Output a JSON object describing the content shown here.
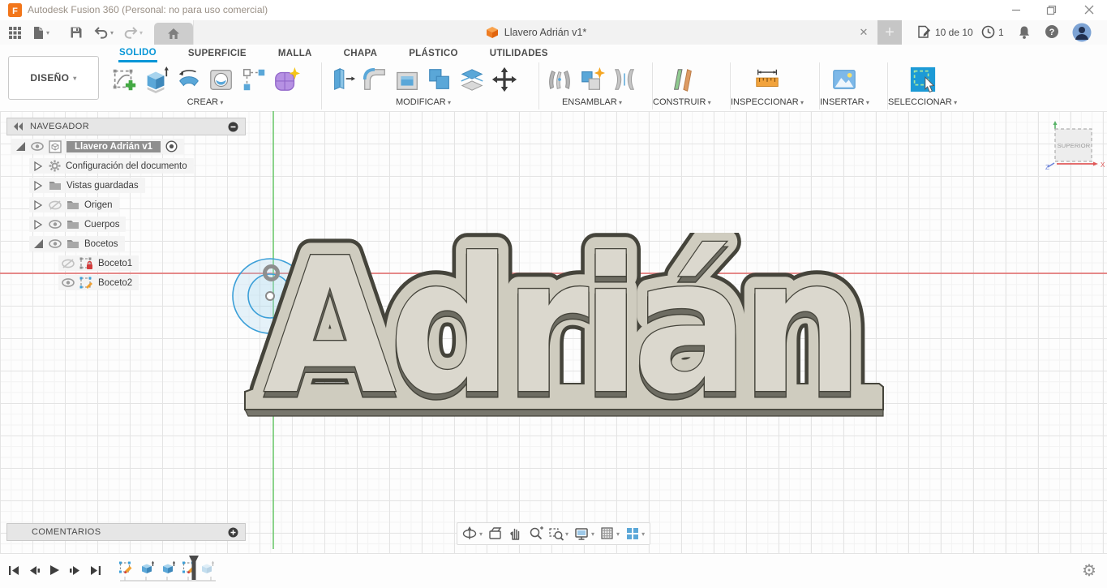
{
  "window": {
    "title": "Autodesk Fusion 360 (Personal: no para uso comercial)"
  },
  "tabs_bar": {
    "document_tab_title": "Llavero Adrián v1*",
    "save_status": "10 de 10",
    "notification_count": "1"
  },
  "ribbon": {
    "workspace_label": "DISEÑO",
    "active_tab": "SOLIDO",
    "tabs": [
      "SOLIDO",
      "SUPERFICIE",
      "MALLA",
      "CHAPA",
      "PLÁSTICO",
      "UTILIDADES"
    ],
    "groups": [
      {
        "label": "CREAR"
      },
      {
        "label": "MODIFICAR"
      },
      {
        "label": "ENSAMBLAR"
      },
      {
        "label": "CONSTRUIR"
      },
      {
        "label": "INSPECCIONAR"
      },
      {
        "label": "INSERTAR"
      },
      {
        "label": "SELECCIONAR"
      }
    ]
  },
  "navigator": {
    "title": "NAVEGADOR",
    "items": [
      {
        "label": "Llavero Adrián v1"
      },
      {
        "label": "Configuración del documento"
      },
      {
        "label": "Vistas guardadas"
      },
      {
        "label": "Origen"
      },
      {
        "label": "Cuerpos"
      },
      {
        "label": "Bocetos"
      },
      {
        "label": "Boceto1"
      },
      {
        "label": "Boceto2"
      }
    ]
  },
  "viewcube": {
    "face_label": "SUPERIOR",
    "axis_x": "X",
    "axis_z": "Z"
  },
  "comments": {
    "title": "COMENTARIOS"
  },
  "canvas": {
    "model_text": "Adrián"
  },
  "colors": {
    "accent_blue": "#0696d7",
    "model_face": "#dbd8ce",
    "model_base": "#cfccbf",
    "model_edge": "#45443b",
    "sketch_blue": "#3b9fd8",
    "axis_red": "#e25f5f",
    "axis_green": "#6ec86e"
  }
}
